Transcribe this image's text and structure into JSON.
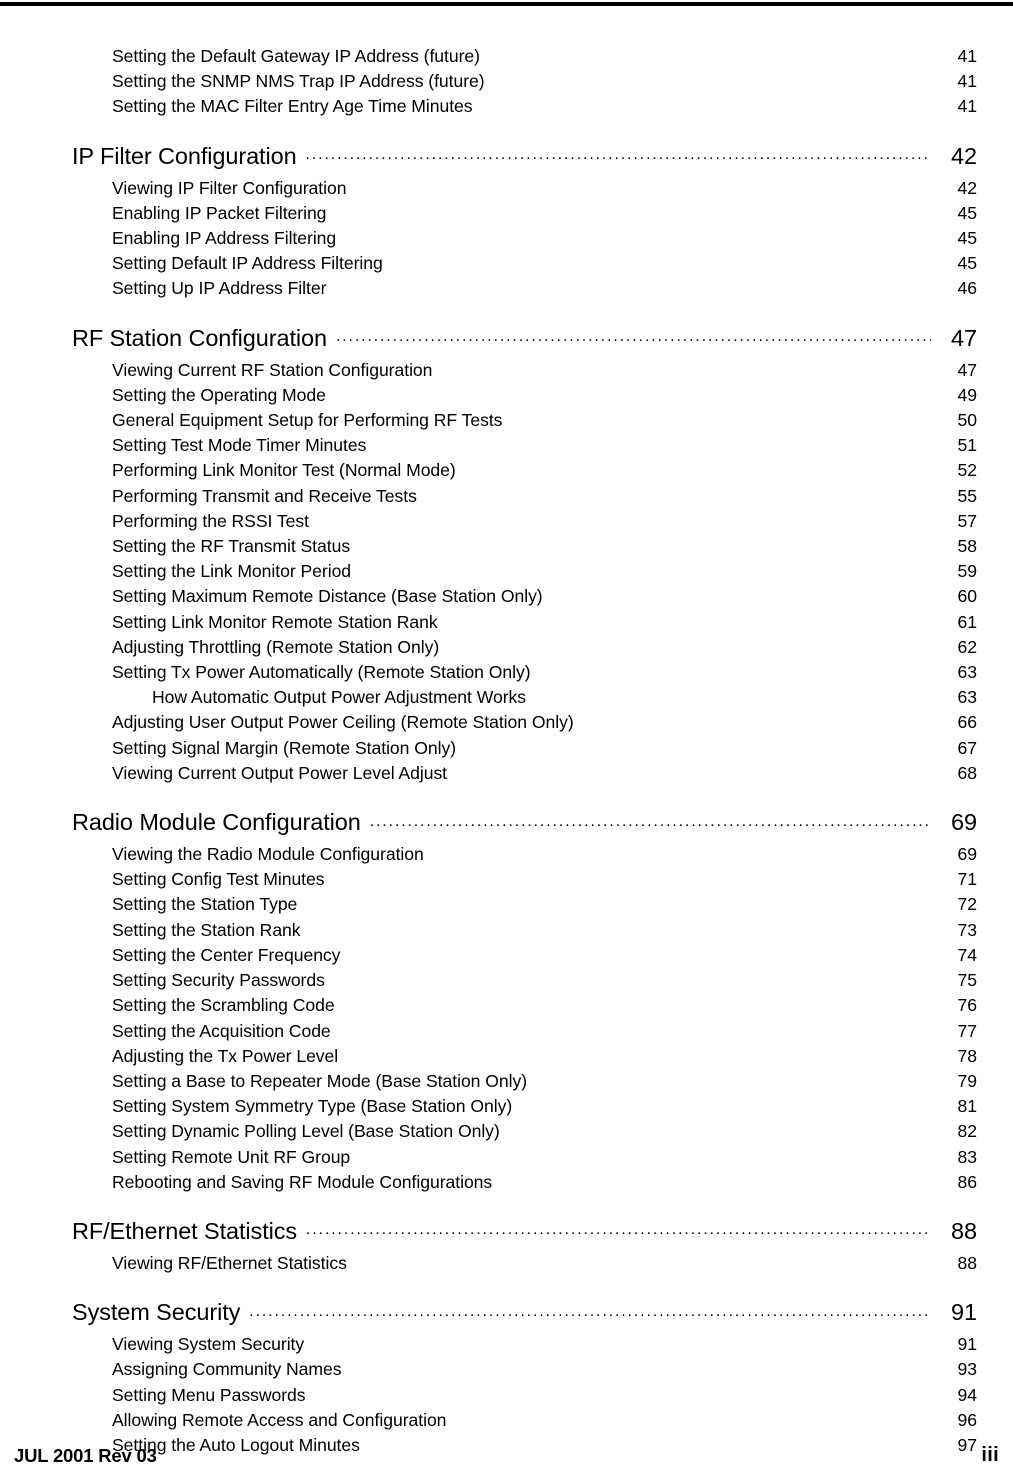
{
  "document": {
    "page_label": "iii",
    "footer_left": "JUL 2001 Rev 03"
  },
  "toc": {
    "entries": [
      {
        "level": 1,
        "title": "Setting the Default Gateway IP Address (future)",
        "page": "41",
        "gap": false
      },
      {
        "level": 1,
        "title": "Setting the SNMP NMS Trap IP Address (future)",
        "page": "41",
        "gap": false
      },
      {
        "level": 1,
        "title": "Setting the MAC Filter Entry Age Time Minutes",
        "page": "41",
        "gap": false
      },
      {
        "level": 0,
        "title": "IP Filter Configuration",
        "page": "42",
        "gap": true
      },
      {
        "level": 1,
        "title": "Viewing IP Filter Configuration",
        "page": "42",
        "gap": false
      },
      {
        "level": 1,
        "title": "Enabling IP Packet Filtering",
        "page": "45",
        "gap": false
      },
      {
        "level": 1,
        "title": "Enabling IP Address Filtering",
        "page": "45",
        "gap": false
      },
      {
        "level": 1,
        "title": "Setting Default IP Address Filtering",
        "page": "45",
        "gap": false
      },
      {
        "level": 1,
        "title": "Setting Up IP Address Filter",
        "page": "46",
        "gap": false
      },
      {
        "level": 0,
        "title": "RF Station Configuration",
        "page": "47",
        "gap": true
      },
      {
        "level": 1,
        "title": "Viewing Current RF Station Configuration",
        "page": "47",
        "gap": false
      },
      {
        "level": 1,
        "title": "Setting the Operating Mode",
        "page": "49",
        "gap": false
      },
      {
        "level": 1,
        "title": "General Equipment Setup for Performing RF Tests",
        "page": "50",
        "gap": false
      },
      {
        "level": 1,
        "title": "Setting Test Mode Timer Minutes",
        "page": "51",
        "gap": false
      },
      {
        "level": 1,
        "title": "Performing Link Monitor Test (Normal Mode)",
        "page": "52",
        "gap": false
      },
      {
        "level": 1,
        "title": "Performing Transmit and Receive Tests",
        "page": "55",
        "gap": false
      },
      {
        "level": 1,
        "title": "Performing the RSSI Test",
        "page": "57",
        "gap": false
      },
      {
        "level": 1,
        "title": "Setting the RF Transmit Status",
        "page": "58",
        "gap": false
      },
      {
        "level": 1,
        "title": "Setting the Link Monitor Period",
        "page": "59",
        "gap": false
      },
      {
        "level": 1,
        "title": "Setting Maximum Remote Distance (Base Station Only)",
        "page": "60",
        "gap": false
      },
      {
        "level": 1,
        "title": "Setting Link Monitor Remote Station Rank",
        "page": "61",
        "gap": false
      },
      {
        "level": 1,
        "title": "Adjusting Throttling (Remote Station Only)",
        "page": "62",
        "gap": false
      },
      {
        "level": 1,
        "title": "Setting Tx Power Automatically (Remote Station Only)",
        "page": "63",
        "gap": false
      },
      {
        "level": 2,
        "title": "How Automatic Output Power Adjustment Works",
        "page": "63",
        "gap": false
      },
      {
        "level": 1,
        "title": "Adjusting User Output Power Ceiling (Remote Station Only)",
        "page": "66",
        "gap": false
      },
      {
        "level": 1,
        "title": "Setting Signal Margin (Remote Station Only)",
        "page": "67",
        "gap": false
      },
      {
        "level": 1,
        "title": "Viewing Current Output Power Level Adjust",
        "page": "68",
        "gap": false
      },
      {
        "level": 0,
        "title": "Radio Module Configuration",
        "page": "69",
        "gap": true
      },
      {
        "level": 1,
        "title": "Viewing the Radio Module Configuration",
        "page": "69",
        "gap": false
      },
      {
        "level": 1,
        "title": "Setting Config Test Minutes",
        "page": "71",
        "gap": false
      },
      {
        "level": 1,
        "title": "Setting the Station Type",
        "page": "72",
        "gap": false
      },
      {
        "level": 1,
        "title": "Setting the Station Rank",
        "page": "73",
        "gap": false
      },
      {
        "level": 1,
        "title": "Setting the Center Frequency",
        "page": "74",
        "gap": false
      },
      {
        "level": 1,
        "title": "Setting Security Passwords",
        "page": "75",
        "gap": false
      },
      {
        "level": 1,
        "title": "Setting the Scrambling Code",
        "page": "76",
        "gap": false
      },
      {
        "level": 1,
        "title": "Setting the Acquisition Code",
        "page": "77",
        "gap": false
      },
      {
        "level": 1,
        "title": "Adjusting the Tx Power Level",
        "page": "78",
        "gap": false
      },
      {
        "level": 1,
        "title": "Setting a Base to Repeater Mode (Base Station Only)",
        "page": "79",
        "gap": false
      },
      {
        "level": 1,
        "title": "Setting System Symmetry Type (Base Station Only)",
        "page": "81",
        "gap": false
      },
      {
        "level": 1,
        "title": "Setting Dynamic Polling Level (Base Station Only)",
        "page": "82",
        "gap": false
      },
      {
        "level": 1,
        "title": "Setting Remote Unit RF Group",
        "page": "83",
        "gap": false
      },
      {
        "level": 1,
        "title": "Rebooting and Saving RF Module Configurations",
        "page": "86",
        "gap": false
      },
      {
        "level": 0,
        "title": "RF/Ethernet Statistics",
        "page": "88",
        "gap": true
      },
      {
        "level": 1,
        "title": "Viewing RF/Ethernet Statistics",
        "page": "88",
        "gap": false
      },
      {
        "level": 0,
        "title": "System Security",
        "page": "91",
        "gap": true
      },
      {
        "level": 1,
        "title": "Viewing System Security",
        "page": "91",
        "gap": false
      },
      {
        "level": 1,
        "title": "Assigning Community Names",
        "page": "93",
        "gap": false
      },
      {
        "level": 1,
        "title": "Setting Menu Passwords",
        "page": "94",
        "gap": false
      },
      {
        "level": 1,
        "title": "Allowing Remote Access and Configuration",
        "page": "96",
        "gap": false
      },
      {
        "level": 1,
        "title": "Setting the Auto Logout Minutes",
        "page": "97",
        "gap": false
      }
    ]
  }
}
